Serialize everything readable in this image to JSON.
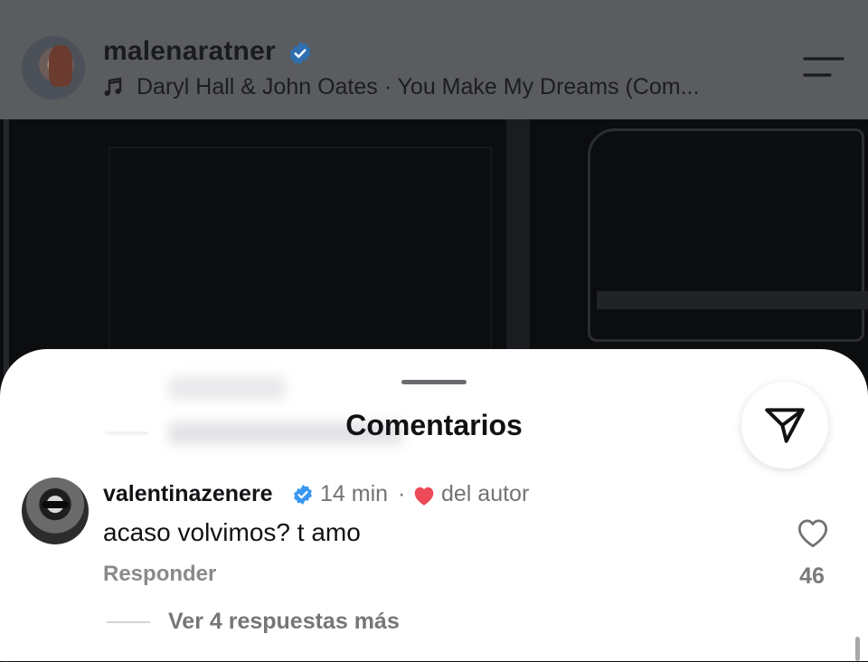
{
  "header": {
    "username": "malenaratner",
    "song": "Daryl Hall & John Oates · You Make My Dreams (Com..."
  },
  "sheet": {
    "title": "Comentarios"
  },
  "comment": {
    "username": "valentinazenere",
    "time": "14 min",
    "separator": "·",
    "author_liked": "del autor",
    "text": "acaso volvimos? t amo",
    "reply_label": "Responder",
    "like_count": "46",
    "view_replies": "Ver 4 respuestas más"
  },
  "colors": {
    "verified": "#3897f0",
    "heart": "#ed4956"
  }
}
